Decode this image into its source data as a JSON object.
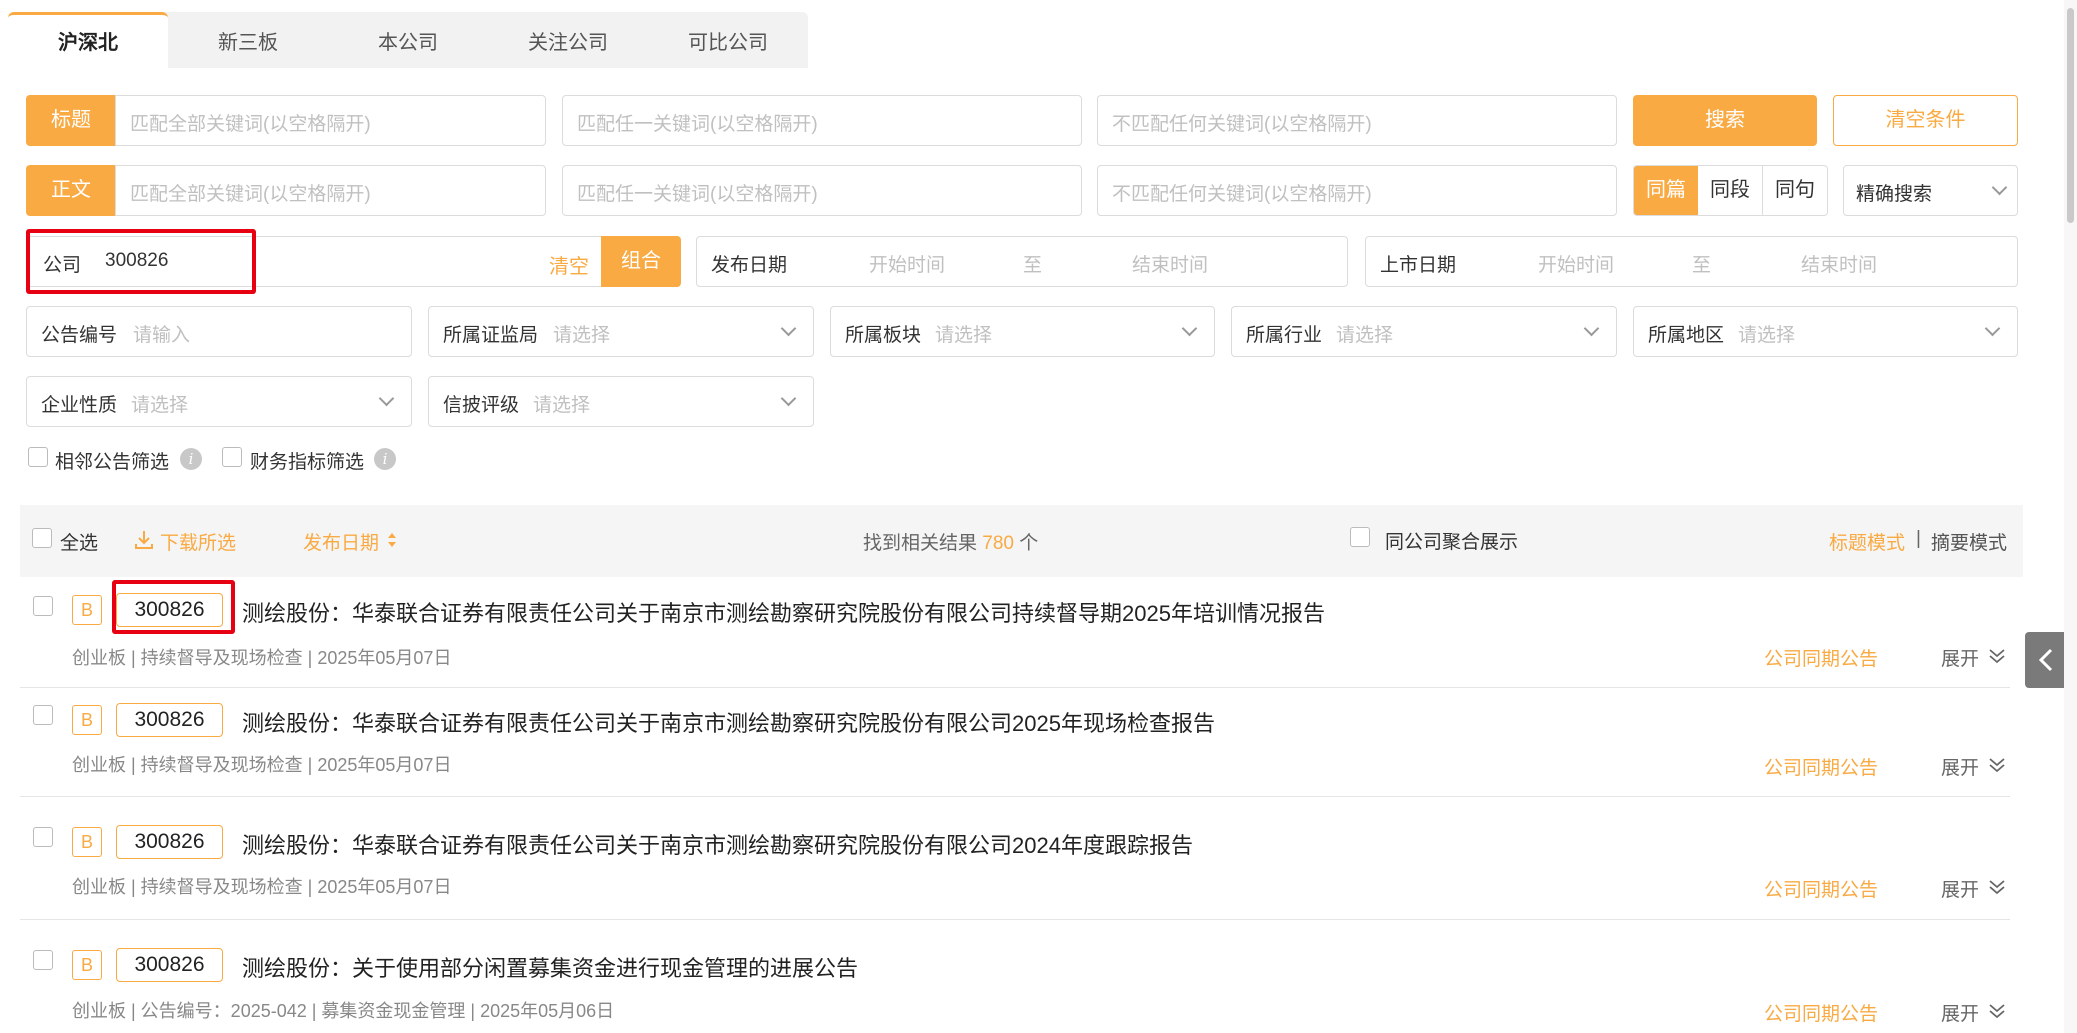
{
  "tabs": [
    "沪深北",
    "新三板",
    "本公司",
    "关注公司",
    "可比公司"
  ],
  "search": {
    "title_label": "标题",
    "body_label": "正文",
    "ph_all": "匹配全部关键词(以空格隔开)",
    "ph_any": "匹配任一关键词(以空格隔开)",
    "ph_none": "不匹配任何关键词(以空格隔开)",
    "search_btn": "搜索",
    "clear_btn": "清空条件",
    "scope": [
      "同篇",
      "同段",
      "同句"
    ],
    "mode": "精确搜索"
  },
  "company": {
    "label": "公司",
    "value": "300826",
    "clear": "清空",
    "combine": "组合"
  },
  "publish_date": {
    "label": "发布日期",
    "start": "开始时间",
    "to": "至",
    "end": "结束时间"
  },
  "listing_date": {
    "label": "上市日期",
    "start": "开始时间",
    "to": "至",
    "end": "结束时间"
  },
  "filters": {
    "ann_no": {
      "label": "公告编号",
      "ph": "请输入"
    },
    "regulator": {
      "label": "所属证监局",
      "ph": "请选择"
    },
    "board": {
      "label": "所属板块",
      "ph": "请选择"
    },
    "industry": {
      "label": "所属行业",
      "ph": "请选择"
    },
    "region": {
      "label": "所属地区",
      "ph": "请选择"
    },
    "nature": {
      "label": "企业性质",
      "ph": "请选择"
    },
    "rating": {
      "label": "信披评级",
      "ph": "请选择"
    }
  },
  "checks": {
    "adjacent": "相邻公告筛选",
    "financial": "财务指标筛选"
  },
  "toolbar": {
    "select_all": "全选",
    "download": "下载所选",
    "sort": "发布日期",
    "found_prefix": "找到相关结果",
    "found_count": "780",
    "found_suffix": "个",
    "group": "同公司聚合展示",
    "title_mode": "标题模式",
    "sep": "|",
    "summary_mode": "摘要模式"
  },
  "results": [
    {
      "badge": "B",
      "code": "300826",
      "title": "测绘股份：华泰联合证券有限责任公司关于南京市测绘勘察研究院股份有限公司持续督导期2025年培训情况报告",
      "meta": "创业板 | 持续督导及现场检查 | 2025年05月07日",
      "same": "公司同期公告",
      "expand": "展开"
    },
    {
      "badge": "B",
      "code": "300826",
      "title": "测绘股份：华泰联合证券有限责任公司关于南京市测绘勘察研究院股份有限公司2025年现场检查报告",
      "meta": "创业板 | 持续督导及现场检查 | 2025年05月07日",
      "same": "公司同期公告",
      "expand": "展开"
    },
    {
      "badge": "B",
      "code": "300826",
      "title": "测绘股份：华泰联合证券有限责任公司关于南京市测绘勘察研究院股份有限公司2024年度跟踪报告",
      "meta": "创业板 | 持续督导及现场检查 | 2025年05月07日",
      "same": "公司同期公告",
      "expand": "展开"
    },
    {
      "badge": "B",
      "code": "300826",
      "title": "测绘股份：关于使用部分闲置募集资金进行现金管理的进展公告",
      "meta": "创业板 | 公告编号：2025-042 | 募集资金现金管理 | 2025年05月06日",
      "same": "公司同期公告",
      "expand": "展开"
    }
  ],
  "colors": {
    "accent": "#f9aa43",
    "highlight": "#e60012"
  }
}
